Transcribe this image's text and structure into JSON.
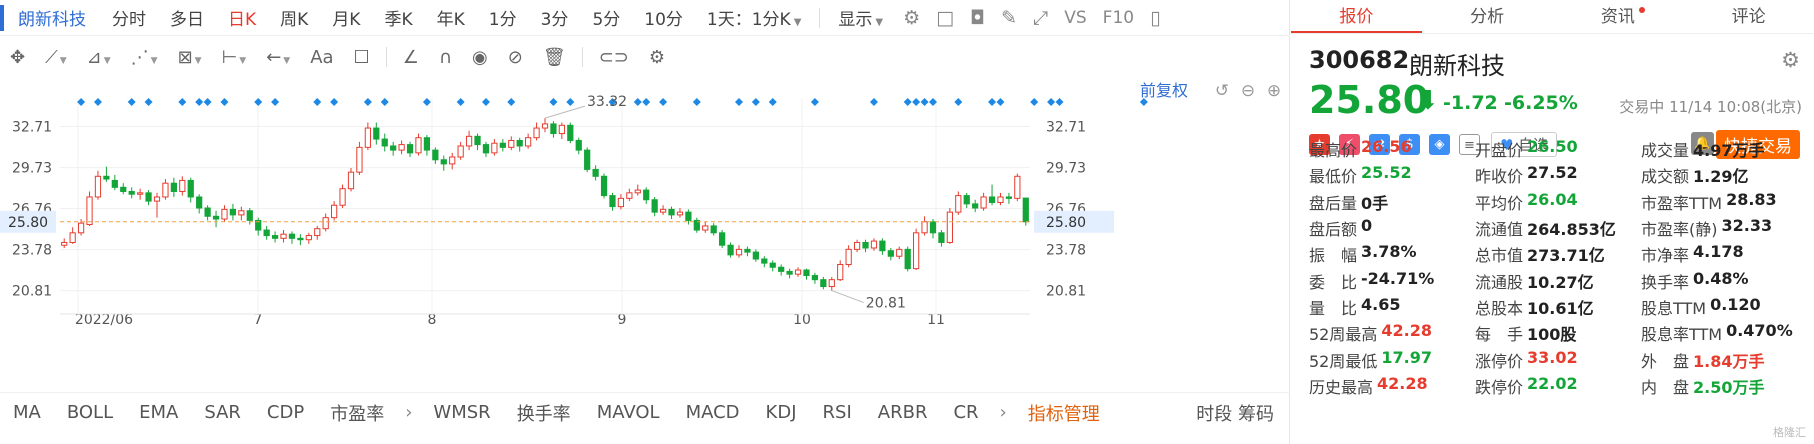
{
  "toolbar": {
    "stock_name": "朗新科技",
    "periods": [
      {
        "label": "分时",
        "active": false
      },
      {
        "label": "多日",
        "active": false
      },
      {
        "label": "日K",
        "active": true
      },
      {
        "label": "周K",
        "active": false
      },
      {
        "label": "月K",
        "active": false
      },
      {
        "label": "季K",
        "active": false
      },
      {
        "label": "年K",
        "active": false
      },
      {
        "label": "1分",
        "active": false
      },
      {
        "label": "3分",
        "active": false
      },
      {
        "label": "5分",
        "active": false
      },
      {
        "label": "10分",
        "active": false
      }
    ],
    "range_select": "1天：1分K",
    "display_label": "显示",
    "vs_label": "VS",
    "f10_label": "F10"
  },
  "chart_header": {
    "adjust_label": "前复权"
  },
  "chart_data": {
    "type": "candlestick",
    "y_ticks": [
      32.71,
      29.73,
      26.76,
      23.78,
      20.81
    ],
    "ylim": [
      19.4,
      34.2
    ],
    "x_labels": [
      "2022/06",
      "7",
      "8",
      "9",
      "10",
      "11"
    ],
    "current_price": 25.8,
    "high_annotation": "33.32",
    "low_annotation": "20.81",
    "candles": [
      {
        "o": 24.1,
        "c": 24.3,
        "h": 24.6,
        "l": 23.9
      },
      {
        "o": 24.3,
        "c": 25.0,
        "h": 25.4,
        "l": 24.2
      },
      {
        "o": 25.0,
        "c": 25.7,
        "h": 26.0,
        "l": 24.8
      },
      {
        "o": 25.6,
        "c": 27.6,
        "h": 28.0,
        "l": 25.5
      },
      {
        "o": 27.6,
        "c": 29.1,
        "h": 29.5,
        "l": 27.4
      },
      {
        "o": 29.1,
        "c": 28.9,
        "h": 29.8,
        "l": 28.7
      },
      {
        "o": 28.8,
        "c": 28.3,
        "h": 29.2,
        "l": 28.1
      },
      {
        "o": 28.3,
        "c": 28.0,
        "h": 28.6,
        "l": 27.8
      },
      {
        "o": 28.0,
        "c": 27.8,
        "h": 28.3,
        "l": 27.5
      },
      {
        "o": 27.8,
        "c": 27.9,
        "h": 28.2,
        "l": 27.4
      },
      {
        "o": 27.9,
        "c": 27.3,
        "h": 28.1,
        "l": 27.0
      },
      {
        "o": 27.3,
        "c": 27.6,
        "h": 27.9,
        "l": 26.1
      },
      {
        "o": 27.6,
        "c": 28.6,
        "h": 28.9,
        "l": 27.4
      },
      {
        "o": 28.6,
        "c": 28.0,
        "h": 29.0,
        "l": 27.6
      },
      {
        "o": 28.0,
        "c": 28.8,
        "h": 29.1,
        "l": 27.7
      },
      {
        "o": 28.8,
        "c": 27.6,
        "h": 29.0,
        "l": 27.2
      },
      {
        "o": 27.6,
        "c": 26.8,
        "h": 27.8,
        "l": 26.4
      },
      {
        "o": 26.8,
        "c": 26.2,
        "h": 27.0,
        "l": 25.9
      },
      {
        "o": 26.2,
        "c": 26.0,
        "h": 26.6,
        "l": 25.4
      },
      {
        "o": 26.0,
        "c": 26.7,
        "h": 27.0,
        "l": 25.8
      },
      {
        "o": 26.7,
        "c": 26.3,
        "h": 27.1,
        "l": 25.9
      },
      {
        "o": 26.3,
        "c": 26.6,
        "h": 26.9,
        "l": 25.9
      },
      {
        "o": 26.6,
        "c": 25.9,
        "h": 26.8,
        "l": 25.6
      },
      {
        "o": 25.9,
        "c": 25.2,
        "h": 26.1,
        "l": 24.8
      },
      {
        "o": 25.2,
        "c": 24.8,
        "h": 25.5,
        "l": 24.5
      },
      {
        "o": 24.8,
        "c": 24.6,
        "h": 25.1,
        "l": 24.3
      },
      {
        "o": 24.6,
        "c": 24.9,
        "h": 25.2,
        "l": 24.3
      },
      {
        "o": 24.9,
        "c": 24.6,
        "h": 25.1,
        "l": 24.2
      },
      {
        "o": 24.6,
        "c": 24.5,
        "h": 24.9,
        "l": 24.1
      },
      {
        "o": 24.5,
        "c": 24.8,
        "h": 25.0,
        "l": 24.2
      },
      {
        "o": 24.8,
        "c": 25.3,
        "h": 25.5,
        "l": 24.5
      },
      {
        "o": 25.3,
        "c": 26.1,
        "h": 26.4,
        "l": 25.1
      },
      {
        "o": 26.1,
        "c": 27.0,
        "h": 27.3,
        "l": 25.9
      },
      {
        "o": 27.0,
        "c": 28.2,
        "h": 28.5,
        "l": 26.8
      },
      {
        "o": 28.2,
        "c": 29.4,
        "h": 29.7,
        "l": 28.0
      },
      {
        "o": 29.4,
        "c": 31.2,
        "h": 31.6,
        "l": 29.2
      },
      {
        "o": 31.2,
        "c": 32.6,
        "h": 33.0,
        "l": 31.0
      },
      {
        "o": 32.6,
        "c": 31.8,
        "h": 33.0,
        "l": 31.4
      },
      {
        "o": 31.8,
        "c": 31.3,
        "h": 32.2,
        "l": 30.9
      },
      {
        "o": 31.3,
        "c": 31.0,
        "h": 31.6,
        "l": 30.6
      },
      {
        "o": 31.0,
        "c": 31.4,
        "h": 31.7,
        "l": 30.7
      },
      {
        "o": 31.4,
        "c": 30.8,
        "h": 31.6,
        "l": 30.5
      },
      {
        "o": 30.8,
        "c": 31.9,
        "h": 32.2,
        "l": 30.6
      },
      {
        "o": 31.9,
        "c": 31.0,
        "h": 32.1,
        "l": 30.6
      },
      {
        "o": 31.0,
        "c": 30.3,
        "h": 31.2,
        "l": 30.0
      },
      {
        "o": 30.3,
        "c": 30.0,
        "h": 30.6,
        "l": 29.5
      },
      {
        "o": 30.0,
        "c": 30.5,
        "h": 30.8,
        "l": 29.6
      },
      {
        "o": 30.5,
        "c": 31.3,
        "h": 31.6,
        "l": 30.3
      },
      {
        "o": 31.3,
        "c": 32.0,
        "h": 32.4,
        "l": 31.0
      },
      {
        "o": 32.0,
        "c": 31.4,
        "h": 32.2,
        "l": 31.0
      },
      {
        "o": 31.4,
        "c": 30.8,
        "h": 31.6,
        "l": 30.5
      },
      {
        "o": 30.8,
        "c": 31.5,
        "h": 31.8,
        "l": 30.6
      },
      {
        "o": 31.5,
        "c": 31.2,
        "h": 31.8,
        "l": 30.9
      },
      {
        "o": 31.2,
        "c": 31.7,
        "h": 32.0,
        "l": 31.0
      },
      {
        "o": 31.7,
        "c": 31.3,
        "h": 31.9,
        "l": 30.9
      },
      {
        "o": 31.3,
        "c": 31.9,
        "h": 32.2,
        "l": 31.1
      },
      {
        "o": 31.9,
        "c": 32.6,
        "h": 33.0,
        "l": 31.7
      },
      {
        "o": 32.6,
        "c": 32.9,
        "h": 33.32,
        "l": 32.3
      },
      {
        "o": 32.9,
        "c": 32.2,
        "h": 33.1,
        "l": 31.9
      },
      {
        "o": 32.2,
        "c": 32.8,
        "h": 33.0,
        "l": 31.8
      },
      {
        "o": 32.8,
        "c": 31.7,
        "h": 33.0,
        "l": 31.5
      },
      {
        "o": 31.7,
        "c": 31.0,
        "h": 31.9,
        "l": 30.7
      },
      {
        "o": 31.0,
        "c": 29.6,
        "h": 31.2,
        "l": 29.4
      },
      {
        "o": 29.6,
        "c": 29.1,
        "h": 29.9,
        "l": 28.8
      },
      {
        "o": 29.1,
        "c": 27.7,
        "h": 29.3,
        "l": 27.5
      },
      {
        "o": 27.7,
        "c": 26.9,
        "h": 27.9,
        "l": 26.6
      },
      {
        "o": 26.9,
        "c": 27.5,
        "h": 27.8,
        "l": 26.7
      },
      {
        "o": 27.5,
        "c": 27.9,
        "h": 28.2,
        "l": 27.3
      },
      {
        "o": 27.9,
        "c": 28.1,
        "h": 28.5,
        "l": 27.7
      },
      {
        "o": 28.1,
        "c": 27.4,
        "h": 28.3,
        "l": 27.1
      },
      {
        "o": 27.4,
        "c": 26.5,
        "h": 27.6,
        "l": 26.2
      },
      {
        "o": 26.5,
        "c": 26.7,
        "h": 27.0,
        "l": 26.3
      },
      {
        "o": 26.7,
        "c": 26.3,
        "h": 26.9,
        "l": 26.0
      },
      {
        "o": 26.3,
        "c": 26.5,
        "h": 26.8,
        "l": 26.1
      },
      {
        "o": 26.5,
        "c": 25.9,
        "h": 26.7,
        "l": 25.6
      },
      {
        "o": 25.9,
        "c": 25.2,
        "h": 26.1,
        "l": 25.0
      },
      {
        "o": 25.2,
        "c": 25.5,
        "h": 25.8,
        "l": 25.0
      },
      {
        "o": 25.5,
        "c": 25.0,
        "h": 25.7,
        "l": 24.8
      },
      {
        "o": 25.0,
        "c": 24.1,
        "h": 25.2,
        "l": 23.9
      },
      {
        "o": 24.1,
        "c": 23.4,
        "h": 24.3,
        "l": 23.2
      },
      {
        "o": 23.4,
        "c": 23.8,
        "h": 24.1,
        "l": 23.2
      },
      {
        "o": 23.8,
        "c": 23.6,
        "h": 24.0,
        "l": 23.3
      },
      {
        "o": 23.6,
        "c": 23.1,
        "h": 23.8,
        "l": 22.9
      },
      {
        "o": 23.1,
        "c": 22.8,
        "h": 23.3,
        "l": 22.5
      },
      {
        "o": 22.8,
        "c": 22.5,
        "h": 23.0,
        "l": 22.2
      },
      {
        "o": 22.5,
        "c": 22.2,
        "h": 22.7,
        "l": 21.9
      },
      {
        "o": 22.2,
        "c": 22.0,
        "h": 22.4,
        "l": 21.7
      },
      {
        "o": 22.0,
        "c": 22.3,
        "h": 22.5,
        "l": 21.8
      },
      {
        "o": 22.3,
        "c": 21.9,
        "h": 22.4,
        "l": 21.6
      },
      {
        "o": 21.9,
        "c": 21.6,
        "h": 22.1,
        "l": 21.3
      },
      {
        "o": 21.6,
        "c": 21.1,
        "h": 21.8,
        "l": 20.9
      },
      {
        "o": 21.1,
        "c": 21.6,
        "h": 21.8,
        "l": 20.81
      },
      {
        "o": 21.6,
        "c": 22.7,
        "h": 23.0,
        "l": 21.5
      },
      {
        "o": 22.7,
        "c": 23.8,
        "h": 24.1,
        "l": 22.5
      },
      {
        "o": 23.8,
        "c": 24.3,
        "h": 24.5,
        "l": 23.6
      },
      {
        "o": 24.3,
        "c": 23.9,
        "h": 24.5,
        "l": 23.6
      },
      {
        "o": 23.9,
        "c": 24.4,
        "h": 24.6,
        "l": 23.7
      },
      {
        "o": 24.4,
        "c": 23.7,
        "h": 24.6,
        "l": 23.4
      },
      {
        "o": 23.7,
        "c": 23.3,
        "h": 23.9,
        "l": 23.0
      },
      {
        "o": 23.3,
        "c": 23.8,
        "h": 24.0,
        "l": 23.1
      },
      {
        "o": 23.8,
        "c": 22.4,
        "h": 24.0,
        "l": 22.2
      },
      {
        "o": 22.4,
        "c": 25.0,
        "h": 25.3,
        "l": 22.3
      },
      {
        "o": 25.0,
        "c": 25.8,
        "h": 26.2,
        "l": 24.8
      },
      {
        "o": 25.8,
        "c": 25.0,
        "h": 26.0,
        "l": 24.6
      },
      {
        "o": 25.0,
        "c": 24.3,
        "h": 25.2,
        "l": 24.0
      },
      {
        "o": 24.3,
        "c": 26.5,
        "h": 26.8,
        "l": 24.2
      },
      {
        "o": 26.5,
        "c": 27.7,
        "h": 28.0,
        "l": 26.3
      },
      {
        "o": 27.7,
        "c": 27.1,
        "h": 27.9,
        "l": 26.8
      },
      {
        "o": 27.1,
        "c": 26.8,
        "h": 27.4,
        "l": 26.5
      },
      {
        "o": 26.8,
        "c": 27.6,
        "h": 27.9,
        "l": 26.6
      },
      {
        "o": 27.6,
        "c": 27.2,
        "h": 28.5,
        "l": 27.0
      },
      {
        "o": 27.2,
        "c": 27.6,
        "h": 27.9,
        "l": 27.0
      },
      {
        "o": 27.6,
        "c": 27.5,
        "h": 27.9,
        "l": 27.1
      },
      {
        "o": 27.5,
        "c": 29.1,
        "h": 29.3,
        "l": 27.3
      },
      {
        "o": 27.52,
        "c": 25.8,
        "h": 26.56,
        "l": 25.52
      }
    ],
    "event_markers": [
      2,
      4,
      8,
      10,
      14,
      16,
      17,
      19,
      23,
      25,
      30,
      32,
      36,
      38,
      43,
      47,
      50,
      53,
      58,
      60,
      65,
      68,
      69,
      71,
      75,
      80,
      82,
      84,
      89,
      96,
      100,
      101,
      102,
      103,
      106,
      110,
      111,
      115,
      117,
      118,
      128
    ]
  },
  "indicators": [
    "MA",
    "BOLL",
    "EMA",
    "SAR",
    "CDP",
    "市盈率",
    "WMSR",
    "换手率",
    "MAVOL",
    "MACD",
    "KDJ",
    "RSI",
    "ARBR",
    "CR"
  ],
  "indicator_manage": "指标管理",
  "bottom_right": "时段 筹码",
  "tabs": [
    "报价",
    "分析",
    "资讯",
    "评论"
  ],
  "quote": {
    "code": "300682",
    "name": "朗新科技",
    "price": "25.80",
    "change": "-1.72",
    "change_pct": "-6.25%",
    "status": "交易中 11/14 10:08(北京)",
    "fav_label": "自选",
    "quick_trade": "快捷交易",
    "rows": [
      [
        {
          "l": "最高价",
          "v": "26.56",
          "c": "red"
        },
        {
          "l": "开盘价",
          "v": "26.50",
          "c": "green"
        },
        {
          "l": "成交量",
          "v": "4.97万手",
          "c": "dark"
        }
      ],
      [
        {
          "l": "最低价",
          "v": "25.52",
          "c": "green"
        },
        {
          "l": "昨收价",
          "v": "27.52",
          "c": "dark"
        },
        {
          "l": "成交额",
          "v": "1.29亿",
          "c": "dark"
        }
      ],
      [
        {
          "l": "盘后量",
          "v": "0手",
          "c": "dark"
        },
        {
          "l": "平均价",
          "v": "26.04",
          "c": "green"
        },
        {
          "l": "市盈率TTM",
          "v": "28.83",
          "c": "dark"
        }
      ],
      [
        {
          "l": "盘后额",
          "v": "0",
          "c": "dark"
        },
        {
          "l": "流通值",
          "v": "264.853亿",
          "c": "dark"
        },
        {
          "l": "市盈率(静)",
          "v": "32.33",
          "c": "dark"
        }
      ],
      [
        {
          "l": "振　幅",
          "v": "3.78%",
          "c": "dark"
        },
        {
          "l": "总市值",
          "v": "273.71亿",
          "c": "dark"
        },
        {
          "l": "市净率",
          "v": "4.178",
          "c": "dark"
        }
      ],
      [
        {
          "l": "委　比",
          "v": "-24.71%",
          "c": "dark"
        },
        {
          "l": "流通股",
          "v": "10.27亿",
          "c": "dark"
        },
        {
          "l": "换手率",
          "v": "0.48%",
          "c": "dark"
        }
      ],
      [
        {
          "l": "量　比",
          "v": "4.65",
          "c": "dark"
        },
        {
          "l": "总股本",
          "v": "10.61亿",
          "c": "dark"
        },
        {
          "l": "股息TTM",
          "v": "0.120",
          "c": "dark"
        }
      ],
      [
        {
          "l": "52周最高",
          "v": "42.28",
          "c": "red"
        },
        {
          "l": "每　手",
          "v": "100股",
          "c": "dark"
        },
        {
          "l": "股息率TTM",
          "v": "0.470%",
          "c": "dark"
        }
      ],
      [
        {
          "l": "52周最低",
          "v": "17.97",
          "c": "green"
        },
        {
          "l": "涨停价",
          "v": "33.02",
          "c": "red"
        },
        {
          "l": "外　盘",
          "v": "1.84万手",
          "c": "red"
        }
      ],
      [
        {
          "l": "历史最高",
          "v": "42.28",
          "c": "red"
        },
        {
          "l": "跌停价",
          "v": "22.02",
          "c": "green"
        },
        {
          "l": "内　盘",
          "v": "2.50万手",
          "c": "green"
        }
      ]
    ]
  },
  "colors": {
    "up": "#e63c2e",
    "down": "#13a538",
    "accent": "#2f6ed4",
    "marker": "#1e88e5"
  }
}
